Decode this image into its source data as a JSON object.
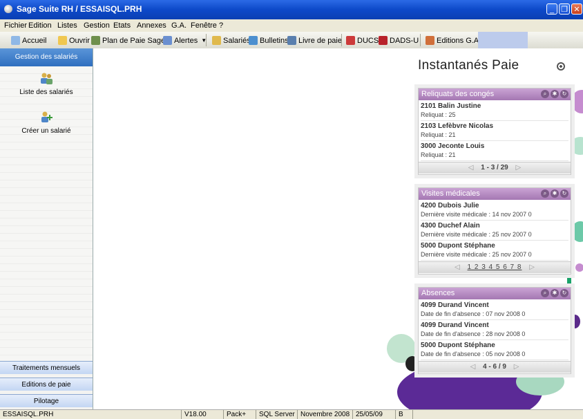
{
  "window": {
    "title": "Sage Suite RH  / ESSAISQL.PRH",
    "minimize": "_",
    "maximize": "❐",
    "close": "✕"
  },
  "menu": [
    "Fichier",
    "Edition",
    "Listes",
    "Gestion",
    "Etats",
    "Annexes",
    "G.A.",
    "Fenêtre",
    "?"
  ],
  "toolbar": {
    "accueil": "Accueil",
    "ouvrir": "Ouvrir",
    "plan": "Plan de Paie Sage",
    "alertes": "Alertes",
    "salaries": "Salariés",
    "bulletins": "Bulletins",
    "livre": "Livre de paie",
    "ducs": "DUCS",
    "dads": "DADS-U",
    "editions": "Editions G.A."
  },
  "sidebar": {
    "header": "Gestion des salariés",
    "tasks": [
      "Liste des salariés",
      "Créer un salarié"
    ],
    "tabs": [
      "Traitements mensuels",
      "Editions de paie",
      "Pilotage"
    ]
  },
  "main": {
    "title": "Instantanés Paie",
    "widgets": [
      {
        "title": "Reliquats des congés",
        "rows": [
          {
            "name": "2101 Balin Justine",
            "detail": "Reliquat : 25"
          },
          {
            "name": "2103 Lefèbvre Nicolas",
            "detail": "Reliquat : 21"
          },
          {
            "name": "3000 Jeconte Louis",
            "detail": "Reliquat : 21"
          }
        ],
        "footer": "1 - 3 / 29"
      },
      {
        "title": "Visites médicales",
        "rows": [
          {
            "name": "4200 Dubois Julie",
            "detail": "Dernière visite médicale : 14 nov 2007 0"
          },
          {
            "name": "4300 Duchef Alain",
            "detail": "Dernière visite médicale : 25 nov 2007 0"
          },
          {
            "name": "5000 Dupont Stéphane",
            "detail": "Dernière visite médicale : 25 nov 2007 0"
          }
        ],
        "footer": "1 2 3 4 5 6 7 8"
      },
      {
        "title": "Absences",
        "rows": [
          {
            "name": "4099 Durand Vincent",
            "detail": "Date de fin d'absence : 07 nov 2008 0"
          },
          {
            "name": "4099 Durand Vincent",
            "detail": "Date de fin d'absence : 28 nov 2008 0"
          },
          {
            "name": "5000 Dupont Stéphane",
            "detail": "Date de fin d'absence : 05 nov 2008 0"
          }
        ],
        "footer": "4 - 6 / 9"
      }
    ]
  },
  "status": [
    "ESSAISQL.PRH",
    "V18.00",
    "Pack+",
    "SQL Server",
    "Novembre 2008",
    "25/05/09",
    "B"
  ],
  "colors": {
    "titlebar": "#0d49c9",
    "widget_header": "#a477b2",
    "sidebar_header": "#2f6fbf"
  }
}
